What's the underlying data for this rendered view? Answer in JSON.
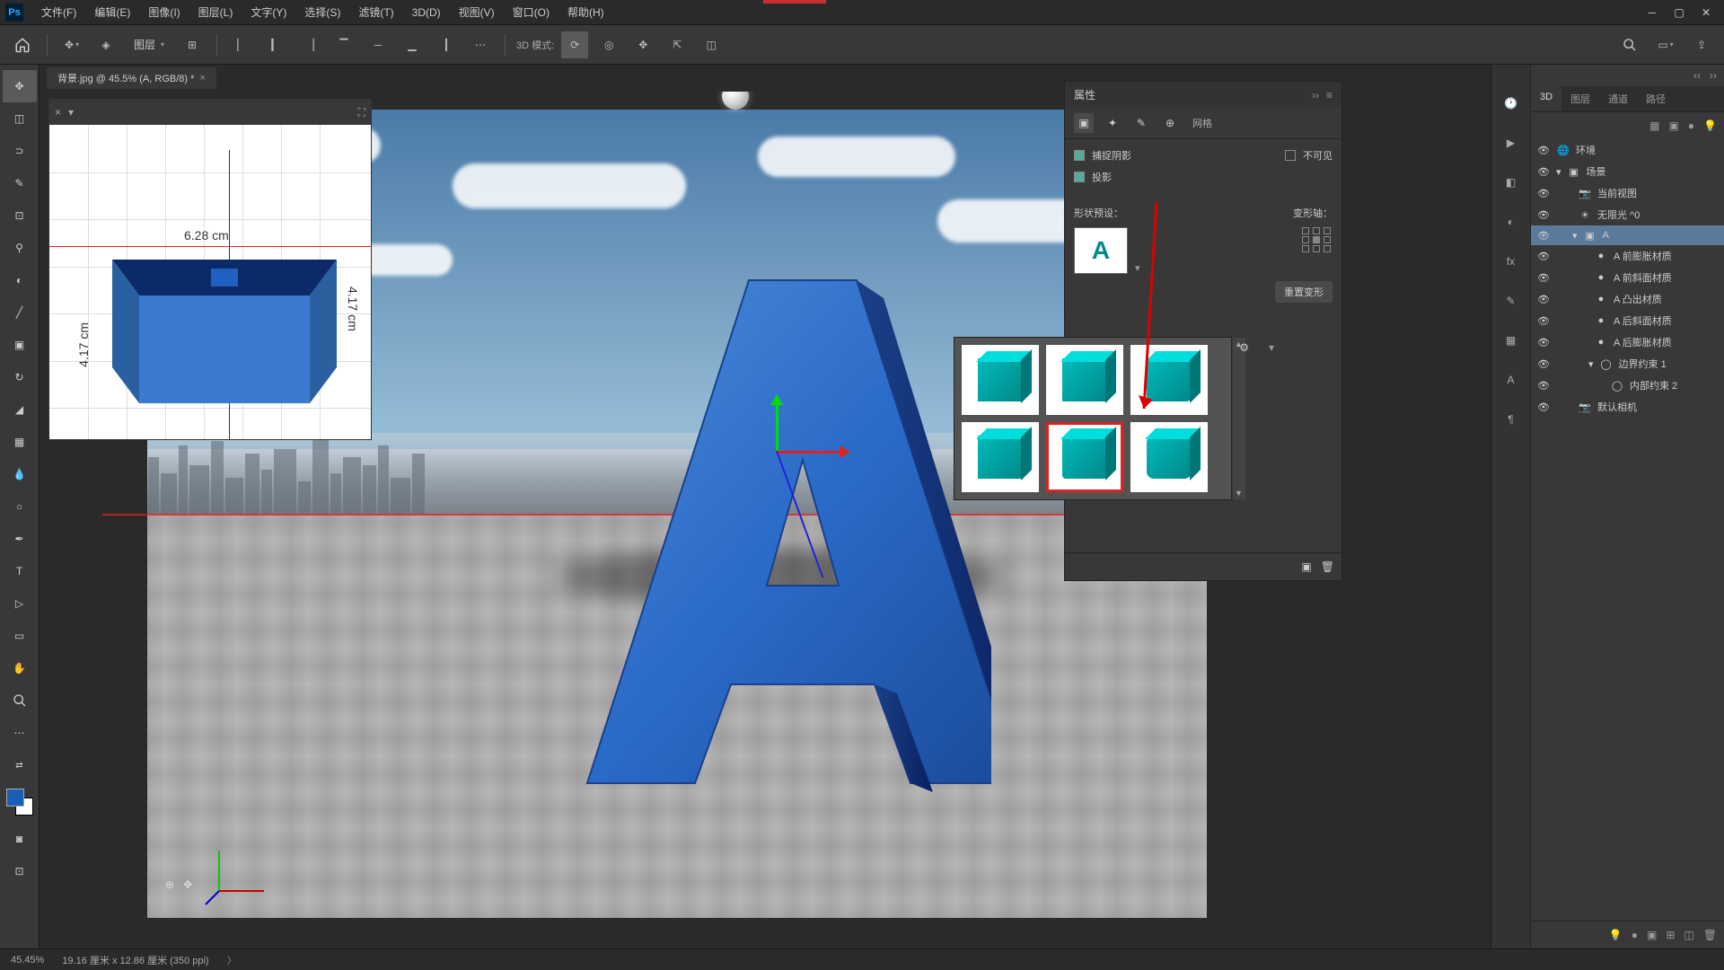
{
  "menu": {
    "file": "文件(F)",
    "edit": "编辑(E)",
    "image": "图像(I)",
    "layer": "图层(L)",
    "type": "文字(Y)",
    "select": "选择(S)",
    "filter": "滤镜(T)",
    "three_d": "3D(D)",
    "view": "视图(V)",
    "window": "窗口(O)",
    "help": "帮助(H)"
  },
  "optbar": {
    "layer_label": "图层",
    "mode_label": "3D 模式:"
  },
  "doc": {
    "tab_title": "背景.jpg @ 45.5% (A, RGB/8) *"
  },
  "status": {
    "zoom": "45.45%",
    "dims": "19.16 厘米 x 12.86 厘米 (350 ppi)"
  },
  "mini": {
    "w": "6.28 cm",
    "h": "4.17 cm",
    "h2": "4.17 cm"
  },
  "props": {
    "title": "属性",
    "mesh": "网格",
    "cast_shadow": "捕捉阴影",
    "proj": "投影",
    "invisible": "不可见",
    "shape_preset": "形状预设：",
    "deform_axis": "变形轴：",
    "reset": "重置变形"
  },
  "panels": {
    "tab_3d": "3D",
    "tab_layers": "图层",
    "tab_channels": "通道",
    "tab_paths": "路径"
  },
  "layers": {
    "env": "环境",
    "scene": "场景",
    "current_view": "当前视图",
    "inf_light": "无限光 ^0",
    "a_layer": "A",
    "mat1": "A 前膨胀材质",
    "mat2": "A 前斜面材质",
    "mat3": "A 凸出材质",
    "mat4": "A 后斜面材质",
    "mat5": "A 后膨胀材质",
    "constraint1": "边界约束 1",
    "constraint2": "内部约束 2",
    "camera": "默认相机"
  }
}
